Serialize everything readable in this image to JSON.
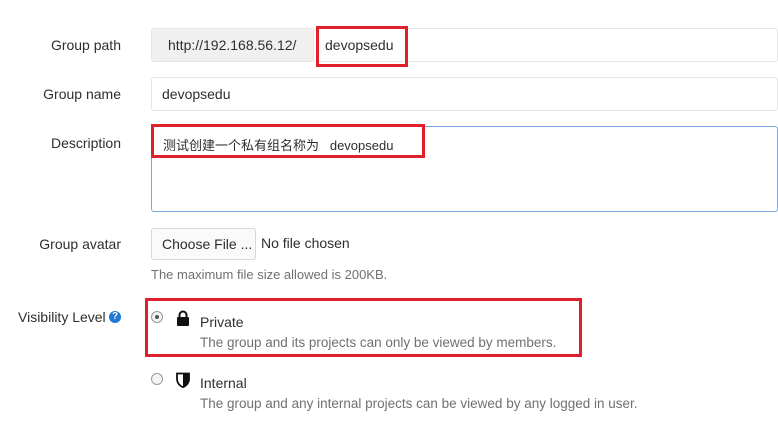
{
  "form": {
    "group_path": {
      "label": "Group path",
      "prefix": "http://192.168.56.12/",
      "value": "devopsedu"
    },
    "group_name": {
      "label": "Group name",
      "value": "devopsedu"
    },
    "description": {
      "label": "Description",
      "value": "测试创建一个私有组名称为   devopsedu"
    },
    "group_avatar": {
      "label": "Group avatar",
      "button": "Choose File ...",
      "status": "No file chosen",
      "help": "The maximum file size allowed is 200KB."
    },
    "visibility": {
      "label": "Visibility Level",
      "help_icon": "question-circle-icon",
      "options": [
        {
          "label": "Private",
          "description": "The group and its projects can only be viewed by members.",
          "icon": "lock-icon",
          "checked": true
        },
        {
          "label": "Internal",
          "description": "The group and any internal projects can be viewed by any logged in user.",
          "icon": "shield-icon",
          "checked": false
        }
      ]
    }
  },
  "colors": {
    "highlight": "#e0202a",
    "help_blue": "#1f78d1"
  }
}
